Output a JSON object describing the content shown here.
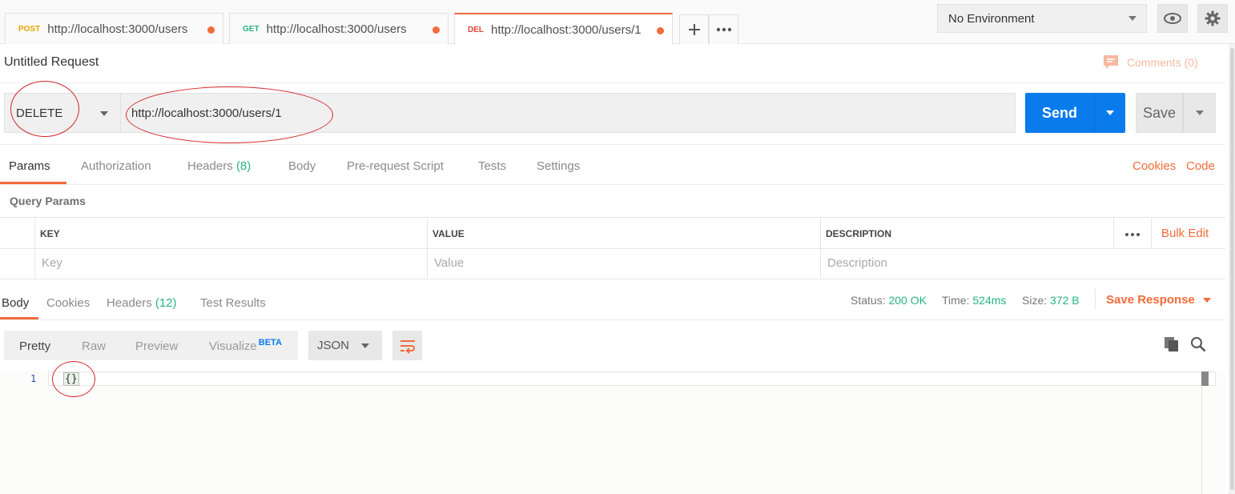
{
  "tabs": [
    {
      "method": "POST",
      "method_color": "#e8a400",
      "url": "http://localhost:3000/users"
    },
    {
      "method": "GET",
      "method_color": "#26b47f",
      "url": "http://localhost:3000/users"
    },
    {
      "method": "DEL",
      "method_color": "#e0443a",
      "url": "http://localhost:3000/users/1"
    }
  ],
  "environment": {
    "selected": "No Environment"
  },
  "request": {
    "title": "Untitled Request",
    "comments": "Comments (0)",
    "method": "DELETE",
    "url": "http://localhost:3000/users/1",
    "send": "Send",
    "save": "Save"
  },
  "request_tabs": {
    "params": "Params",
    "authorization": "Authorization",
    "headers": "Headers",
    "headers_count": "(8)",
    "body": "Body",
    "prerequest": "Pre-request Script",
    "tests": "Tests",
    "settings": "Settings",
    "cookies": "Cookies",
    "code": "Code"
  },
  "params": {
    "section": "Query Params",
    "col_key": "KEY",
    "col_value": "VALUE",
    "col_description": "DESCRIPTION",
    "bulk_edit": "Bulk Edit",
    "ph_key": "Key",
    "ph_value": "Value",
    "ph_description": "Description"
  },
  "response": {
    "tab_body": "Body",
    "tab_cookies": "Cookies",
    "tab_headers": "Headers",
    "tab_headers_count": "(12)",
    "tab_tests": "Test Results",
    "status_label": "Status:",
    "status": "200 OK",
    "time_label": "Time:",
    "time": "524ms",
    "size_label": "Size:",
    "size": "372 B",
    "save_response": "Save Response",
    "fmt_pretty": "Pretty",
    "fmt_raw": "Raw",
    "fmt_preview": "Preview",
    "fmt_visualize": "Visualize",
    "beta": "BETA",
    "lang": "JSON",
    "line_number": "1",
    "code": "{}"
  },
  "colors": {
    "accent": "#f26b3a",
    "primary": "#097bed",
    "success": "#26b47f",
    "annotation": "#d4262b"
  }
}
